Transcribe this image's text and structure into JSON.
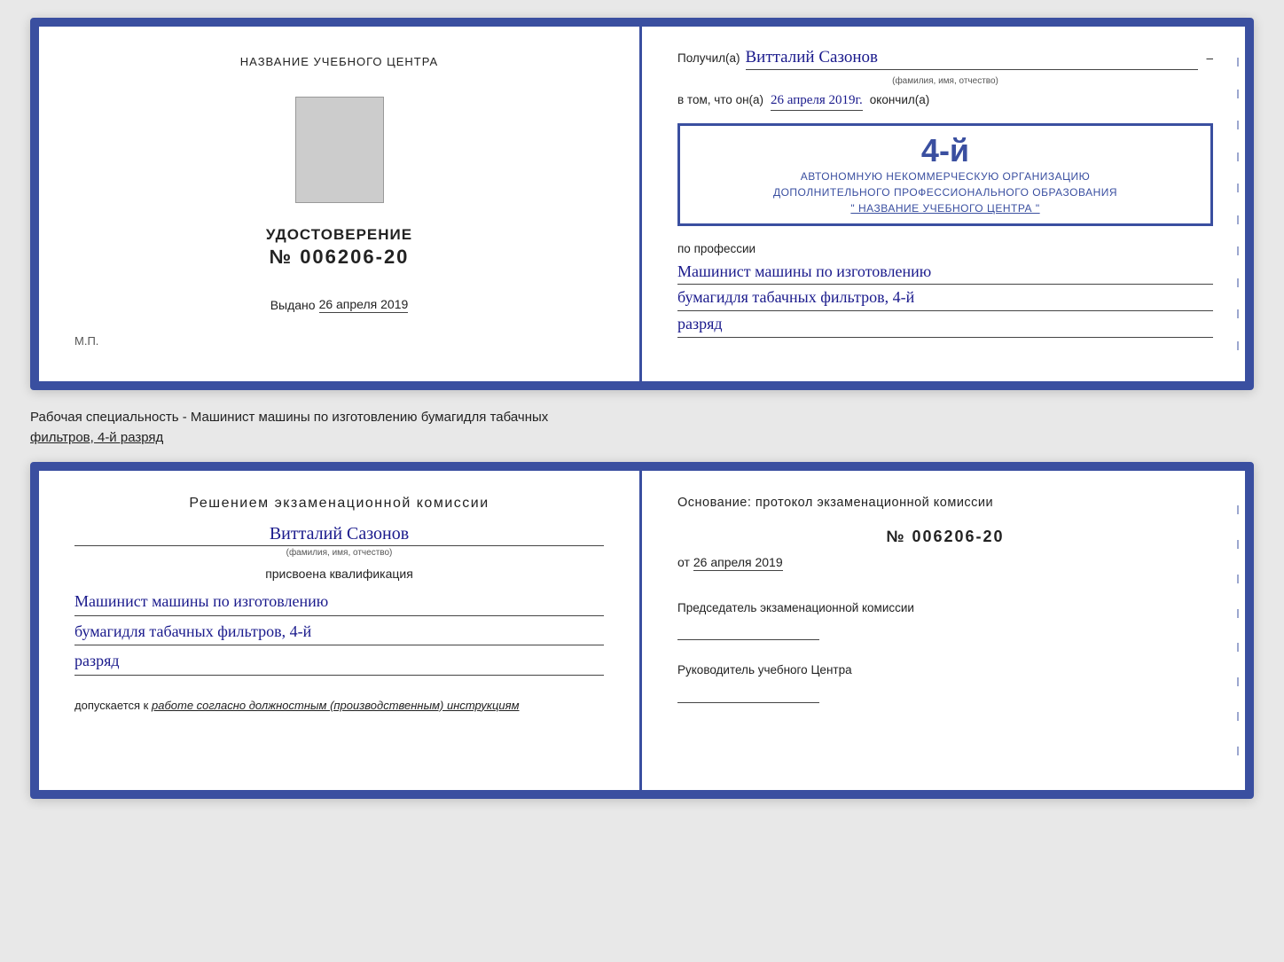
{
  "cert_top": {
    "left": {
      "header_label": "НАЗВАНИЕ УЧЕБНОГО ЦЕНТРА",
      "cert_title": "УДОСТОВЕРЕНИЕ",
      "cert_number": "№ 006206-20",
      "issued_prefix": "Выдано",
      "issued_date": "26 апреля 2019",
      "mp_label": "М.П."
    },
    "right": {
      "recipient_prefix": "Получил(а)",
      "recipient_name": "Витталий Сазонов",
      "recipient_subfootnote": "(фамилия, имя, отчество)",
      "date_prefix": "в том, что он(а)",
      "date_value": "26 апреля 2019г.",
      "okoncil_label": "окончил(а)",
      "stamp_big": "4-й",
      "stamp_line1": "АВТОНОМНУЮ НЕКОММЕРЧЕСКУЮ ОРГАНИЗАЦИЮ",
      "stamp_line2": "ДОПОЛНИТЕЛЬНОГО ПРОФЕССИОНАЛЬНОГО ОБРАЗОВАНИЯ",
      "stamp_line3": "\" НАЗВАНИЕ УЧЕБНОГО ЦЕНТРА \"",
      "profession_label": "по профессии",
      "profession_line1": "Машинист машины по изготовлению",
      "profession_line2": "бумагидля табачных фильтров, 4-й",
      "profession_line3": "разряд"
    }
  },
  "caption": {
    "line1": "Рабочая специальность - Машинист машины по изготовлению бумагидля табачных",
    "line2": "фильтров, 4-й разряд"
  },
  "cert_bottom": {
    "left": {
      "heading": "Решением экзаменационной комиссии",
      "name": "Витталий Сазонов",
      "name_subfootnote": "(фамилия, имя, отчество)",
      "prisvoyena_label": "присвоена квалификация",
      "qual_line1": "Машинист машины по изготовлению",
      "qual_line2": "бумагидля табачных фильтров, 4-й",
      "qual_line3": "разряд",
      "dopusk_prefix": "допускается к",
      "dopusk_text": "работе согласно должностным (производственным) инструкциям"
    },
    "right": {
      "osnov_label": "Основание: протокол экзаменационной комиссии",
      "protocol_number": "№ 006206-20",
      "date_prefix": "от",
      "date_value": "26 апреля 2019",
      "predsedatel_label": "Председатель экзаменационной комиссии",
      "rukovoditel_label": "Руководитель учебного Центра"
    }
  }
}
